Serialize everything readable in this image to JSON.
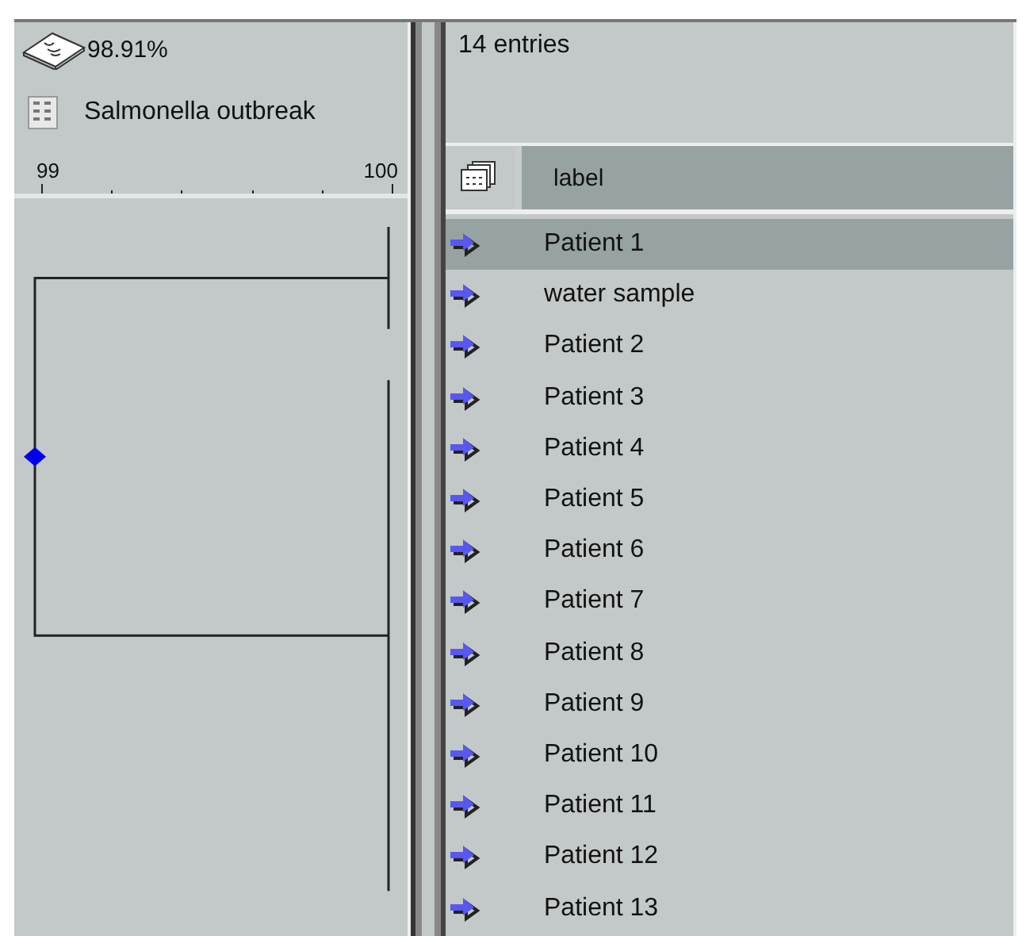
{
  "similarity": {
    "value": "98.91%"
  },
  "experiment": {
    "name": "Salmonella outbreak"
  },
  "scale": {
    "labels": [
      "99",
      "100"
    ]
  },
  "entries_count": "14 entries",
  "table": {
    "columns": [
      "label"
    ],
    "rows": [
      {
        "label": "Patient 1",
        "selected": true
      },
      {
        "label": "water sample",
        "selected": false
      },
      {
        "label": "Patient 2",
        "selected": false
      },
      {
        "label": "Patient 3",
        "selected": false
      },
      {
        "label": "Patient 4",
        "selected": false
      },
      {
        "label": "Patient 5",
        "selected": false
      },
      {
        "label": "Patient 6",
        "selected": false
      },
      {
        "label": "Patient 7",
        "selected": false
      },
      {
        "label": "Patient 8",
        "selected": false
      },
      {
        "label": "Patient 9",
        "selected": false
      },
      {
        "label": "Patient 10",
        "selected": false
      },
      {
        "label": "Patient 11",
        "selected": false
      },
      {
        "label": "Patient 12",
        "selected": false
      },
      {
        "label": "Patient 13",
        "selected": false
      }
    ]
  }
}
